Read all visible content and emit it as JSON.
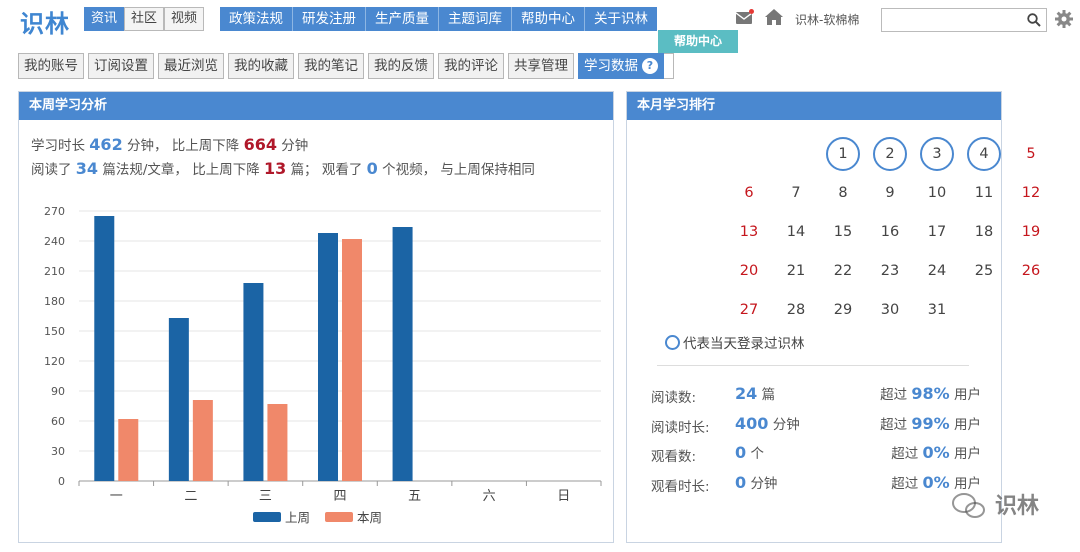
{
  "header": {
    "logo": "识林",
    "segments": [
      {
        "label": "资讯",
        "active": true
      },
      {
        "label": "社区",
        "active": false
      },
      {
        "label": "视频",
        "active": false
      }
    ],
    "nav": [
      "政策法规",
      "研发注册",
      "生产质量",
      "主题词库",
      "帮助中心",
      "关于识林"
    ],
    "tooltip": "帮助中心",
    "username": "识林-软棉棉",
    "search": {
      "value": "",
      "placeholder": ""
    }
  },
  "subnav": {
    "items": [
      "我的账号",
      "订阅设置",
      "最近浏览",
      "我的收藏",
      "我的笔记",
      "我的反馈",
      "我的评论",
      "共享管理",
      "学习数据"
    ],
    "active_index": 8,
    "help_badge": "?"
  },
  "weekly": {
    "title": "本周学习分析",
    "line1": {
      "p1": "学习时长",
      "v1": "462",
      "p2": "分钟， 比上周下降",
      "v2": "664",
      "p3": "分钟"
    },
    "line2": {
      "p1": "阅读了",
      "v1": "34",
      "p2": "篇法规/文章， 比上周下降",
      "v2": "13",
      "p3": "篇； 观看了",
      "v3": "0",
      "p4": "个视频， 与上周保持相同"
    }
  },
  "chart_data": {
    "type": "bar",
    "categories": [
      "一",
      "二",
      "三",
      "四",
      "五",
      "六",
      "日"
    ],
    "series": [
      {
        "name": "上周",
        "color": "#1b64a5",
        "values": [
          265,
          163,
          198,
          248,
          254,
          null,
          null
        ]
      },
      {
        "name": "本周",
        "color": "#f0886a",
        "values": [
          62,
          81,
          77,
          242,
          null,
          null,
          null
        ]
      }
    ],
    "yticks": [
      0,
      30,
      60,
      90,
      120,
      150,
      180,
      210,
      240,
      270
    ],
    "ylim": [
      0,
      270
    ],
    "grid": true,
    "legend_position": "bottom-center"
  },
  "monthly": {
    "title": "本月学习排行",
    "calendar": {
      "days": [
        {
          "d": "1",
          "visited": true,
          "weekend": false
        },
        {
          "d": "2",
          "visited": true,
          "weekend": false
        },
        {
          "d": "3",
          "visited": true,
          "weekend": false
        },
        {
          "d": "4",
          "visited": true,
          "weekend": false
        },
        {
          "d": "5",
          "visited": false,
          "weekend": true
        },
        {
          "d": "6",
          "visited": false,
          "weekend": true
        },
        {
          "d": "7",
          "visited": false,
          "weekend": false
        },
        {
          "d": "8",
          "visited": false,
          "weekend": false
        },
        {
          "d": "9",
          "visited": false,
          "weekend": false
        },
        {
          "d": "10",
          "visited": false,
          "weekend": false
        },
        {
          "d": "11",
          "visited": false,
          "weekend": false
        },
        {
          "d": "12",
          "visited": false,
          "weekend": true
        },
        {
          "d": "13",
          "visited": false,
          "weekend": true
        },
        {
          "d": "14",
          "visited": false,
          "weekend": false
        },
        {
          "d": "15",
          "visited": false,
          "weekend": false
        },
        {
          "d": "16",
          "visited": false,
          "weekend": false
        },
        {
          "d": "17",
          "visited": false,
          "weekend": false
        },
        {
          "d": "18",
          "visited": false,
          "weekend": false
        },
        {
          "d": "19",
          "visited": false,
          "weekend": true
        },
        {
          "d": "20",
          "visited": false,
          "weekend": true
        },
        {
          "d": "21",
          "visited": false,
          "weekend": false
        },
        {
          "d": "22",
          "visited": false,
          "weekend": false
        },
        {
          "d": "23",
          "visited": false,
          "weekend": false
        },
        {
          "d": "24",
          "visited": false,
          "weekend": false
        },
        {
          "d": "25",
          "visited": false,
          "weekend": false
        },
        {
          "d": "26",
          "visited": false,
          "weekend": true
        },
        {
          "d": "27",
          "visited": false,
          "weekend": true
        },
        {
          "d": "28",
          "visited": false,
          "weekend": false
        },
        {
          "d": "29",
          "visited": false,
          "weekend": false
        },
        {
          "d": "30",
          "visited": false,
          "weekend": false
        },
        {
          "d": "31",
          "visited": false,
          "weekend": false
        }
      ],
      "first_weekday": 2,
      "legend": "代表当天登录过识林"
    },
    "stats": [
      {
        "label": "阅读数:",
        "value": "24",
        "unit": "篇",
        "prefix": "超过",
        "pct": "98%",
        "suffix": "用户"
      },
      {
        "label": "阅读时长:",
        "value": "400",
        "unit": "分钟",
        "prefix": "超过",
        "pct": "99%",
        "suffix": "用户"
      },
      {
        "label": "观看数:",
        "value": "0",
        "unit": "个",
        "prefix": "超过",
        "pct": "0%",
        "suffix": "用户"
      },
      {
        "label": "观看时长:",
        "value": "0",
        "unit": "分钟",
        "prefix": "超过",
        "pct": "0%",
        "suffix": "用户"
      }
    ]
  },
  "watermark": "识林",
  "colors": {
    "accent": "#4a88d0",
    "red": "#b0182a",
    "weekend": "#c5161d",
    "tooltip": "#5bbdc3"
  }
}
